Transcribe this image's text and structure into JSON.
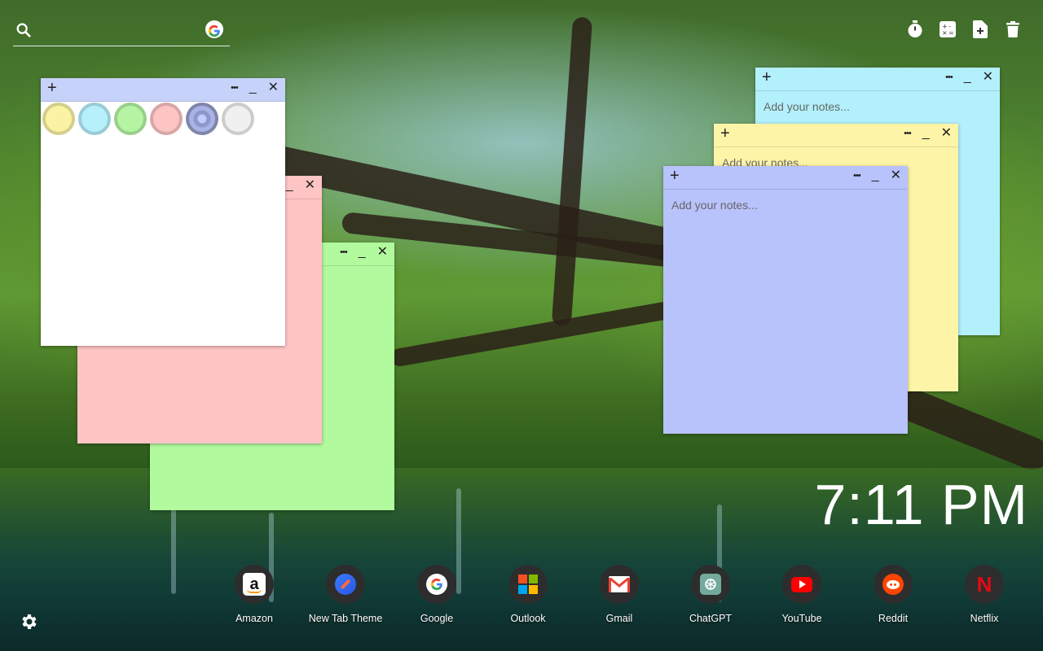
{
  "search": {
    "icon": "search-icon",
    "engine_icon": "google-icon"
  },
  "toolbar": {
    "icons": [
      "timer-icon",
      "calculator-icon",
      "new-note-icon",
      "trash-icon"
    ]
  },
  "notes": {
    "white": {
      "add": "+",
      "more": "•••",
      "minimize": "_",
      "close": "✕",
      "swatches": [
        "#fbf3a4",
        "#b6f0fb",
        "#b5f4a3",
        "#fdc4c4",
        "#b9c3fb",
        "#f0f0f0"
      ]
    },
    "pink": {
      "minimize": "_",
      "close": "✕"
    },
    "green": {
      "more": "•••",
      "minimize": "_",
      "close": "✕"
    },
    "cyan": {
      "add": "+",
      "more": "•••",
      "minimize": "_",
      "close": "✕",
      "placeholder": "Add your notes..."
    },
    "yellow": {
      "add": "+",
      "more": "•••",
      "minimize": "_",
      "close": "✕",
      "placeholder": "Add your notes..."
    },
    "blue": {
      "add": "+",
      "more": "•••",
      "minimize": "_",
      "close": "✕",
      "placeholder": "Add your notes..."
    }
  },
  "note_colors": {
    "white": "#ffffff",
    "pink": "#ffc4c4",
    "green": "#b2fa9e",
    "cyan": "#b2f0fc",
    "yellow": "#fef4a7",
    "blue": "#b8c2fb",
    "header_white": "#c7d2fb"
  },
  "clock": {
    "time": "7:11 PM"
  },
  "dock": {
    "apps": [
      {
        "label": "Amazon",
        "icon": "amazon-icon"
      },
      {
        "label": "New Tab Theme",
        "icon": "new-tab-theme-icon"
      },
      {
        "label": "Google",
        "icon": "google-icon"
      },
      {
        "label": "Outlook",
        "icon": "outlook-icon"
      },
      {
        "label": "Gmail",
        "icon": "gmail-icon"
      },
      {
        "label": "ChatGPT",
        "icon": "chatgpt-icon"
      },
      {
        "label": "YouTube",
        "icon": "youtube-icon"
      },
      {
        "label": "Reddit",
        "icon": "reddit-icon"
      },
      {
        "label": "Netflix",
        "icon": "netflix-icon"
      }
    ],
    "settings_icon": "gear-icon"
  }
}
